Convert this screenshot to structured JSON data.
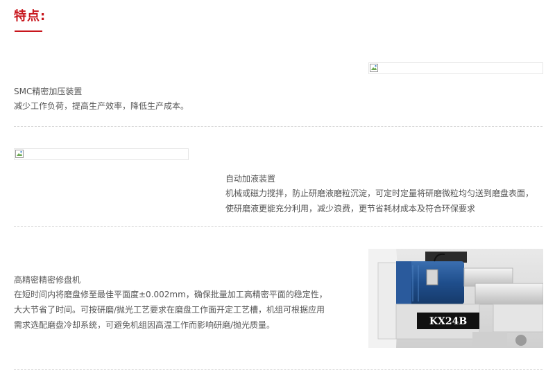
{
  "header": {
    "title": "特点:"
  },
  "features": [
    {
      "title": "SMC精密加压装置",
      "desc": "减少工作负荷，提高生产效率，降低生产成本。"
    },
    {
      "title": "自动加液装置",
      "desc": "机械或磁力搅拌，防止研磨液磨粒沉淀，可定时定量将研磨微粒均匀送到磨盘表面，\n使研磨液更能充分利用，减少浪费，更节省耗材成本及符合环保要求"
    },
    {
      "title": "高精密精密修盘机",
      "desc": "在短时间内将磨盘修至最佳平面度±0.002mm，确保批量加工高精密平面的稳定性，\n大大节省了时间。可按研磨/抛光工艺要求在磨盘工作面开定工艺槽，机组可根据应用\n需求选配磨盘冷却系统，可避免机组因高温工作而影响研磨/抛光质量。"
    }
  ],
  "photo": {
    "label": "KX24B"
  },
  "colors": {
    "accent": "#c8161d",
    "text": "#555555",
    "divider": "#d7d7d7"
  },
  "icons": {
    "image_placeholder": "broken-image-icon"
  }
}
